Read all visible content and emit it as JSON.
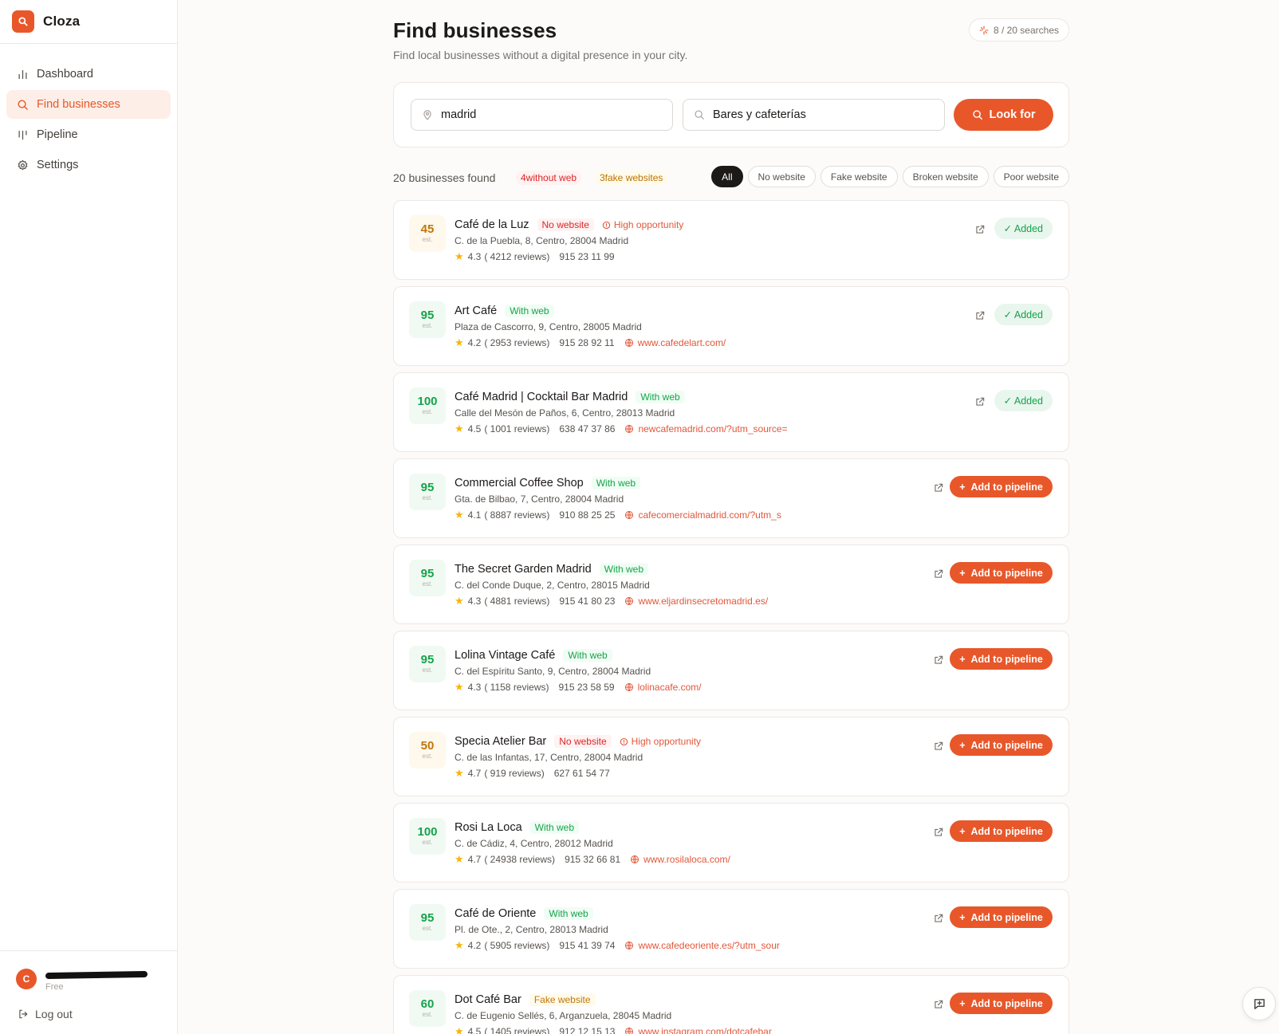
{
  "app": {
    "name": "Cloza"
  },
  "sidebar": {
    "items": [
      {
        "label": "Dashboard",
        "icon": "bar-chart-icon"
      },
      {
        "label": "Find businesses",
        "icon": "search-icon",
        "active": true
      },
      {
        "label": "Pipeline",
        "icon": "kanban-icon"
      },
      {
        "label": "Settings",
        "icon": "gear-icon"
      }
    ]
  },
  "user": {
    "initial": "C",
    "plan": "Free",
    "logout_label": "Log out"
  },
  "header": {
    "title": "Find businesses",
    "subtitle": "Find local businesses without a digital presence in your city.",
    "quota": "8 / 20 searches"
  },
  "search": {
    "city_value": "madrid",
    "category_value": "Bares y cafeterías",
    "button_label": "Look for"
  },
  "results": {
    "count_label": "20 businesses found",
    "without_web_label": "4without web",
    "fake_label": "3fake websites",
    "filters": [
      "All",
      "No website",
      "Fake website",
      "Broken website",
      "Poor website"
    ]
  },
  "labels": {
    "est": "est.",
    "added": "✓ Added",
    "add_pipeline": "Add to pipeline",
    "high_opportunity": "High opportunity"
  },
  "colors": {
    "accent": "#e8572a",
    "success": "#16a34a",
    "warning": "#c2750a",
    "danger": "#dc2626"
  },
  "businesses": [
    {
      "score": "45",
      "score_tone": "amber",
      "name": "Café de la Luz",
      "status": "No website",
      "status_type": "noweb",
      "high_opportunity": true,
      "address": "C. de la Puebla, 8, Centro, 28004 Madrid",
      "rating": "4.3",
      "reviews": "( 4212 reviews)",
      "phone": "915 23 11 99",
      "website": "",
      "added": true
    },
    {
      "score": "95",
      "score_tone": "green",
      "name": "Art Café",
      "status": "With web",
      "status_type": "withweb",
      "high_opportunity": false,
      "address": "Plaza de Cascorro, 9, Centro, 28005 Madrid",
      "rating": "4.2",
      "reviews": "( 2953 reviews)",
      "phone": "915 28 92 11",
      "website": "www.cafedelart.com/",
      "added": true
    },
    {
      "score": "100",
      "score_tone": "green",
      "name": "Café Madrid | Cocktail Bar Madrid",
      "status": "With web",
      "status_type": "withweb",
      "high_opportunity": false,
      "address": "Calle del Mesón de Paños, 6, Centro, 28013 Madrid",
      "rating": "4.5",
      "reviews": "( 1001 reviews)",
      "phone": "638 47 37 86",
      "website": "newcafemadrid.com/?utm_source=",
      "added": true
    },
    {
      "score": "95",
      "score_tone": "green",
      "name": "Commercial Coffee Shop",
      "status": "With web",
      "status_type": "withweb",
      "high_opportunity": false,
      "address": "Gta. de Bilbao, 7, Centro, 28004 Madrid",
      "rating": "4.1",
      "reviews": "( 8887 reviews)",
      "phone": "910 88 25 25",
      "website": "cafecomercialmadrid.com/?utm_s",
      "added": false
    },
    {
      "score": "95",
      "score_tone": "green",
      "name": "The Secret Garden Madrid",
      "status": "With web",
      "status_type": "withweb",
      "high_opportunity": false,
      "address": "C. del Conde Duque, 2, Centro, 28015 Madrid",
      "rating": "4.3",
      "reviews": "( 4881 reviews)",
      "phone": "915 41 80 23",
      "website": "www.eljardinsecretomadrid.es/",
      "added": false
    },
    {
      "score": "95",
      "score_tone": "green",
      "name": "Lolina Vintage Café",
      "status": "With web",
      "status_type": "withweb",
      "high_opportunity": false,
      "address": "C. del Espíritu Santo, 9, Centro, 28004 Madrid",
      "rating": "4.3",
      "reviews": "( 1158 reviews)",
      "phone": "915 23 58 59",
      "website": "lolinacafe.com/",
      "added": false
    },
    {
      "score": "50",
      "score_tone": "amber",
      "name": "Specia Atelier Bar",
      "status": "No website",
      "status_type": "noweb",
      "high_opportunity": true,
      "address": "C. de las Infantas, 17, Centro, 28004 Madrid",
      "rating": "4.7",
      "reviews": "( 919 reviews)",
      "phone": "627 61 54 77",
      "website": "",
      "added": false
    },
    {
      "score": "100",
      "score_tone": "green",
      "name": "Rosi La Loca",
      "status": "With web",
      "status_type": "withweb",
      "high_opportunity": false,
      "address": "C. de Cádiz, 4, Centro, 28012 Madrid",
      "rating": "4.7",
      "reviews": "( 24938 reviews)",
      "phone": "915 32 66 81",
      "website": "www.rosilaloca.com/",
      "added": false
    },
    {
      "score": "95",
      "score_tone": "green",
      "name": "Café de Oriente",
      "status": "With web",
      "status_type": "withweb",
      "high_opportunity": false,
      "address": "Pl. de Ote., 2, Centro, 28013 Madrid",
      "rating": "4.2",
      "reviews": "( 5905 reviews)",
      "phone": "915 41 39 74",
      "website": "www.cafedeoriente.es/?utm_sour",
      "added": false
    },
    {
      "score": "60",
      "score_tone": "green",
      "name": "Dot Café Bar",
      "status": "Fake website",
      "status_type": "fake",
      "high_opportunity": false,
      "address": "C. de Eugenio Sellés, 6, Arganzuela, 28045 Madrid",
      "rating": "4.5",
      "reviews": "( 1405 reviews)",
      "phone": "912 12 15 13",
      "website": "www.instagram.com/dotcafebar",
      "added": false
    }
  ]
}
